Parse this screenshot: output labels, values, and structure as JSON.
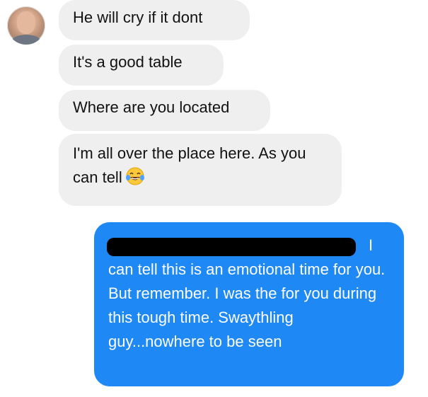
{
  "contact": {
    "avatar_icon": "contact-avatar-photo"
  },
  "messages_in": [
    {
      "text": "He will cry if it dont"
    },
    {
      "text": "It's a good table"
    },
    {
      "text": "Where are you located"
    },
    {
      "text_before_emoji": "I'm all over the place here. As you can tell",
      "emoji_icon": "face-with-tears-of-joy-icon"
    }
  ],
  "message_out": {
    "redacted": true,
    "first_line_tail": "I",
    "body": "can tell this is an emotional time for you. But remember. I was the for you during this tough time. Swaythling guy...nowhere to be seen"
  },
  "colors": {
    "incoming_bubble": "#efefef",
    "outgoing_bubble": "#1e88f5",
    "redaction": "#000000"
  }
}
